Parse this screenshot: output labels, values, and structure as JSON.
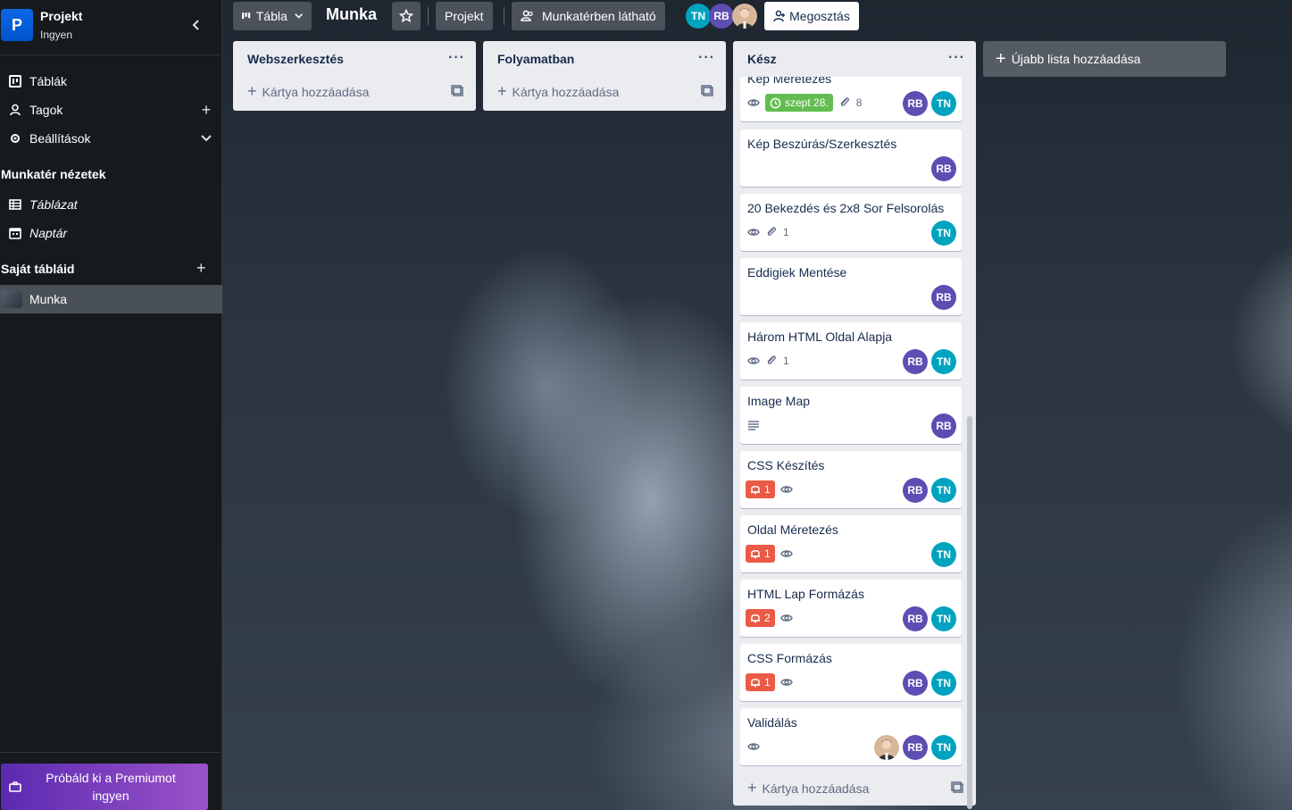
{
  "workspace": {
    "logo_letter": "P",
    "name": "Projekt",
    "plan": "Ingyen"
  },
  "sidebar": {
    "items": [
      {
        "label": "Táblák",
        "icon": "board-icon"
      },
      {
        "label": "Tagok",
        "icon": "person-icon"
      },
      {
        "label": "Beállítások",
        "icon": "gear-icon"
      }
    ],
    "views_title": "Munkatér nézetek",
    "views": [
      {
        "label": "Táblázat",
        "icon": "table-icon"
      },
      {
        "label": "Naptár",
        "icon": "calendar-icon"
      }
    ],
    "boards_title": "Saját tábláid",
    "boards": [
      {
        "label": "Munka"
      }
    ],
    "premium_label": "Próbáld ki a Premiumot ingyen"
  },
  "topbar": {
    "view_label": "Tábla",
    "board_title": "Munka",
    "workspace_button": "Projekt",
    "visibility_button": "Munkatérben látható",
    "share_button": "Megosztás",
    "members": [
      "TN",
      "RB"
    ]
  },
  "lists": [
    {
      "title": "Webszerkesztés",
      "add_card": "Kártya hozzáadása"
    },
    {
      "title": "Folyamatban",
      "add_card": "Kártya hozzáadása"
    },
    {
      "title": "Kész",
      "add_card": "Kártya hozzáadása"
    }
  ],
  "done_cards": [
    {
      "title": "Kép Méretezés",
      "due": "szept 28.",
      "attachments": "8",
      "members": [
        "RB",
        "TN"
      ]
    },
    {
      "title": "Kép Beszúrás/Szerkesztés",
      "members": [
        "RB"
      ]
    },
    {
      "title": "20 Bekezdés és 2x8 Sor Felsorolás",
      "attachments": "1",
      "members": [
        "TN"
      ]
    },
    {
      "title": "Eddigiek Mentése",
      "members": [
        "RB"
      ]
    },
    {
      "title": "Három HTML Oldal Alapja",
      "attachments": "1",
      "members": [
        "RB",
        "TN"
      ]
    },
    {
      "title": "Image Map",
      "members": [
        "RB"
      ]
    },
    {
      "title": "CSS Készítés",
      "notifications": "1",
      "members": [
        "RB",
        "TN"
      ]
    },
    {
      "title": "Oldal Méretezés",
      "notifications": "1",
      "members": [
        "TN"
      ]
    },
    {
      "title": "HTML Lap Formázás",
      "notifications": "2",
      "members": [
        "RB",
        "TN"
      ]
    },
    {
      "title": "CSS Formázás",
      "notifications": "1",
      "members": [
        "RB",
        "TN"
      ]
    },
    {
      "title": "Validálás",
      "members": [
        "RB",
        "TN"
      ]
    }
  ],
  "add_list_label": "Újabb lista hozzáadása",
  "colors": {
    "sidebar_bg": "#161a1d",
    "list_bg": "#ebecf0",
    "due_green": "#61bd4f",
    "alert_red": "#eb5a46",
    "avatar_tn": "#00a3bf",
    "avatar_rb": "#5e4db2",
    "premium_start": "#5b2ab0",
    "premium_end": "#9b53c9"
  }
}
